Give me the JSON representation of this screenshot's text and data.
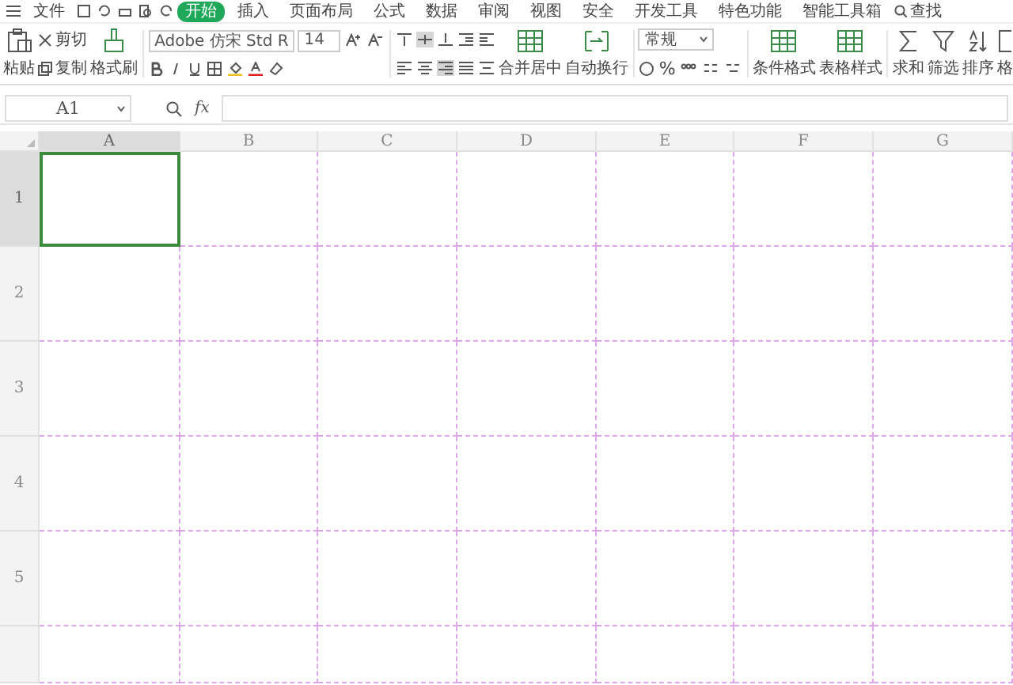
{
  "menu_tabs": [
    {
      "label": "文件",
      "selected": false
    },
    {
      "label": "开始",
      "selected": true
    },
    {
      "label": "插入",
      "selected": false
    },
    {
      "label": "页面布局",
      "selected": false
    },
    {
      "label": "公式",
      "selected": false
    },
    {
      "label": "数据",
      "selected": false
    },
    {
      "label": "审阅",
      "selected": false
    },
    {
      "label": "视图",
      "selected": false
    },
    {
      "label": "安全",
      "selected": false
    },
    {
      "label": "开发工具",
      "selected": false
    },
    {
      "label": "特色功能",
      "selected": false
    },
    {
      "label": "智能工具箱",
      "selected": false
    }
  ],
  "search": {
    "label": "查找"
  },
  "ribbon": {
    "paste": "粘贴",
    "cut": "剪切",
    "copy": "复制",
    "format_painter": "格式刷",
    "font_name": "Adobe 仿宋 Std R",
    "font_size": "14",
    "merge": "合并居中",
    "wrap": "自动换行",
    "number_format": "常规",
    "percent": "%",
    "conditional_format": "条件格式",
    "table_style": "表格样式",
    "sum": "求和",
    "filter": "筛选",
    "sort": "排序",
    "cut_off": "格"
  },
  "formula_bar": {
    "name_box": "A1",
    "fx": "fx"
  },
  "sheet": {
    "columns": [
      {
        "label": "A",
        "selected": true
      },
      {
        "label": "B",
        "selected": false
      },
      {
        "label": "C",
        "selected": false
      },
      {
        "label": "D",
        "selected": false
      },
      {
        "label": "E",
        "selected": false
      },
      {
        "label": "F",
        "selected": false
      },
      {
        "label": "G",
        "selected": false
      }
    ],
    "rows": [
      {
        "label": "1",
        "selected": true
      },
      {
        "label": "2",
        "selected": false
      },
      {
        "label": "3",
        "selected": false
      },
      {
        "label": "4",
        "selected": false
      },
      {
        "label": "5",
        "selected": false
      }
    ]
  }
}
